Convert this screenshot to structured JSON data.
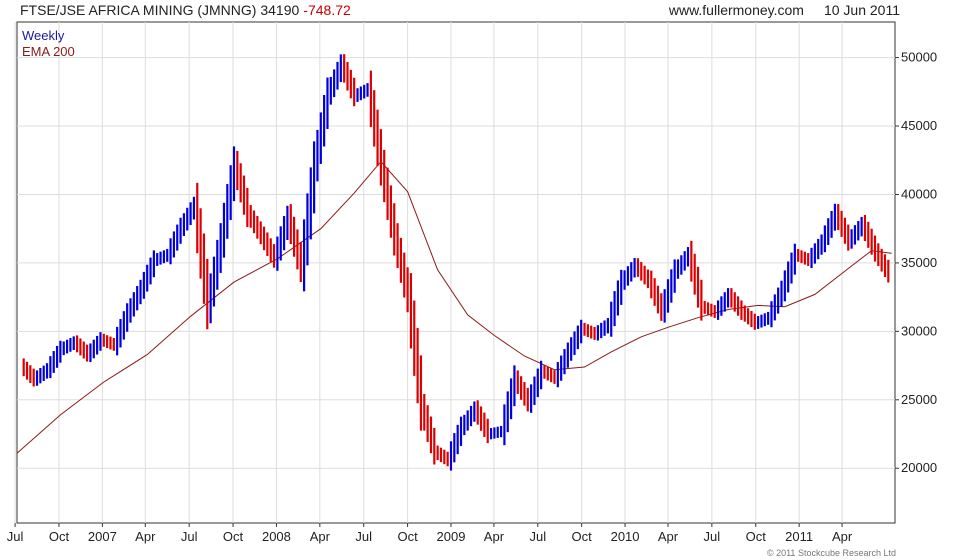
{
  "header": {
    "title": "FTSE/JSE AFRICA MINING (JMNNG)",
    "last": "34190",
    "change": "-748.72",
    "site": "www.fullermoney.com",
    "date": "10 Jun 2011"
  },
  "footer": {
    "copyright": "© 2011 Stockcube Research Ltd"
  },
  "chart_data": {
    "type": "line",
    "title": "FTSE/JSE AFRICA MINING (JMNNG)",
    "legend": [
      {
        "name": "Weekly",
        "color": "#1a1aa0"
      },
      {
        "name": "EMA 200",
        "color": "#8b1a1a"
      }
    ],
    "legend_placement": "top-left",
    "grid": true,
    "colors": {
      "up": "#0000dd",
      "down": "#dd0000",
      "ema": "#8b1a1a"
    },
    "x_ticks": [
      "Jul",
      "Oct",
      "2007",
      "Apr",
      "Jul",
      "Oct",
      "2008",
      "Apr",
      "Jul",
      "Oct",
      "2009",
      "Apr",
      "Jul",
      "Oct",
      "2010",
      "Apr",
      "Jul",
      "Oct",
      "2011",
      "Apr"
    ],
    "y_ticks": [
      "20000",
      "25000",
      "30000",
      "35000",
      "40000",
      "45000",
      "50000"
    ],
    "ylim": [
      16000,
      52600
    ],
    "xlim": [
      "2006-06-05",
      "2011-06-20"
    ],
    "series": [
      {
        "name": "Weekly",
        "x": [
          "2006-06-12",
          "2006-07-10",
          "2006-08-07",
          "2006-09-04",
          "2006-10-02",
          "2006-10-30",
          "2006-11-27",
          "2006-12-25",
          "2007-01-22",
          "2007-02-19",
          "2007-03-19",
          "2007-04-16",
          "2007-05-14",
          "2007-06-11",
          "2007-07-09",
          "2007-08-06",
          "2007-09-03",
          "2007-10-01",
          "2007-10-29",
          "2007-11-26",
          "2007-12-24",
          "2008-01-21",
          "2008-02-18",
          "2008-03-17",
          "2008-04-14",
          "2008-05-12",
          "2008-06-09",
          "2008-07-07",
          "2008-08-04",
          "2008-09-01",
          "2008-09-29",
          "2008-10-27",
          "2008-11-24",
          "2008-12-22",
          "2009-01-19",
          "2009-02-16",
          "2009-03-16",
          "2009-04-13",
          "2009-05-11",
          "2009-06-08",
          "2009-07-06",
          "2009-08-03",
          "2009-08-31",
          "2009-09-28",
          "2009-10-26",
          "2009-11-23",
          "2009-12-21",
          "2010-01-18",
          "2010-02-15",
          "2010-03-15",
          "2010-04-12",
          "2010-05-10",
          "2010-06-07",
          "2010-07-05",
          "2010-08-02",
          "2010-08-30",
          "2010-09-27",
          "2010-10-25",
          "2010-11-22",
          "2010-12-20",
          "2011-01-17",
          "2011-02-14",
          "2011-03-14",
          "2011-04-11",
          "2011-05-09",
          "2011-06-06"
        ],
        "values": [
          27500,
          26500,
          27200,
          28700,
          29200,
          28300,
          29400,
          29000,
          31300,
          33100,
          35200,
          35600,
          37600,
          39200,
          31800,
          36700,
          42200,
          38600,
          37000,
          35300,
          38300,
          34600,
          42200,
          47300,
          49500,
          47200,
          47700,
          42000,
          36800,
          32500,
          24500,
          21200,
          20600,
          23000,
          24300,
          22500,
          22700,
          26500,
          24800,
          27100,
          26600,
          28500,
          30200,
          29800,
          30500,
          33600,
          34800,
          33700,
          31500,
          34400,
          35600,
          31800,
          31400,
          32600,
          31400,
          30600,
          31000,
          33000,
          35600,
          35200,
          36500,
          38600,
          36600,
          37800,
          35800,
          34200
        ]
      },
      {
        "name": "EMA 200",
        "x": [
          "2006-06-05",
          "2006-09-04",
          "2006-12-04",
          "2007-03-05",
          "2007-06-04",
          "2007-09-03",
          "2007-12-03",
          "2008-03-03",
          "2008-05-12",
          "2008-07-07",
          "2008-09-01",
          "2008-11-03",
          "2009-01-05",
          "2009-03-02",
          "2009-05-04",
          "2009-07-06",
          "2009-09-07",
          "2009-11-02",
          "2010-01-04",
          "2010-03-01",
          "2010-05-03",
          "2010-07-05",
          "2010-09-06",
          "2010-11-01",
          "2011-01-03",
          "2011-03-07",
          "2011-05-02",
          "2011-06-13"
        ],
        "values": [
          21100,
          23900,
          26300,
          28300,
          31100,
          33600,
          35300,
          37500,
          40100,
          42400,
          40200,
          34500,
          31200,
          29700,
          28200,
          27200,
          27400,
          28500,
          29600,
          30300,
          31000,
          31600,
          31900,
          31800,
          32700,
          34400,
          35900,
          35700
        ]
      }
    ]
  }
}
